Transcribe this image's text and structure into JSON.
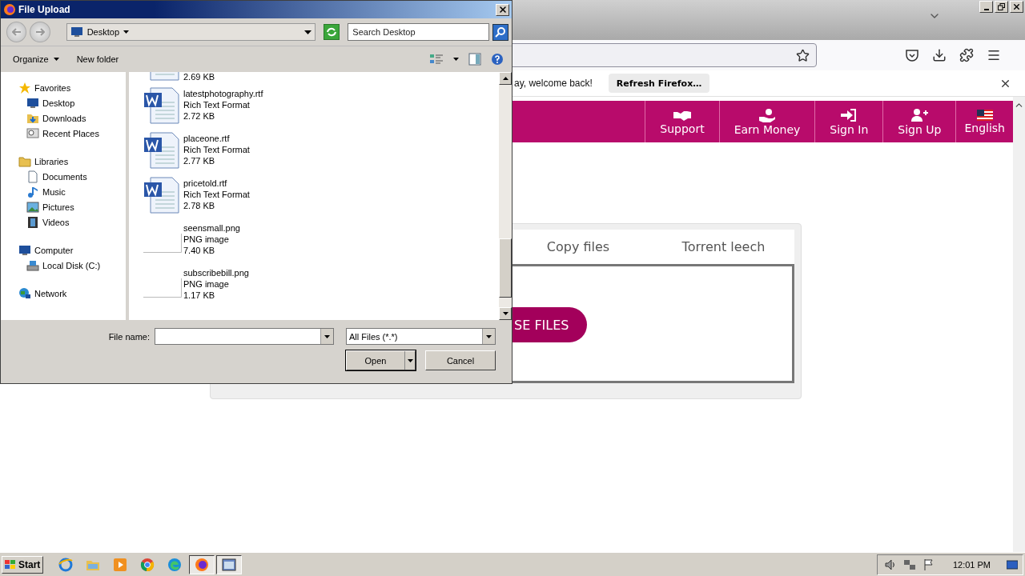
{
  "browser": {
    "notification": {
      "message": "ay, welcome back!",
      "button": "Refresh Firefox…"
    }
  },
  "site": {
    "nav": [
      {
        "label": "Support"
      },
      {
        "label": "Earn Money"
      },
      {
        "label": "Sign In"
      },
      {
        "label": "Sign Up"
      },
      {
        "label": "English"
      }
    ],
    "tabs": [
      {
        "label": "Copy files"
      },
      {
        "label": "Torrent leech"
      }
    ],
    "choose_button": "SE FILES"
  },
  "dialog": {
    "title": "File Upload",
    "location": "Desktop",
    "search": {
      "placeholder": "Search Desktop"
    },
    "commands": [
      {
        "label": "Organize",
        "kind": "menu"
      },
      {
        "label": "New folder",
        "kind": "plain"
      }
    ],
    "navigation": [
      {
        "label": "Favorites",
        "children": [
          {
            "label": "Desktop"
          },
          {
            "label": "Downloads"
          },
          {
            "label": "Recent Places"
          }
        ]
      },
      {
        "label": "Libraries",
        "children": [
          {
            "label": "Documents"
          },
          {
            "label": "Music"
          },
          {
            "label": "Pictures"
          },
          {
            "label": "Videos"
          }
        ]
      },
      {
        "label": "Computer",
        "children": [
          {
            "label": "Local Disk (C:)"
          }
        ]
      },
      {
        "label": "Network"
      }
    ],
    "files": [
      {
        "kind": "partial",
        "size": "2.69 KB"
      },
      {
        "kind": "document",
        "name": "latestphotography.rtf",
        "type": "Rich Text Format",
        "size": "2.72 KB"
      },
      {
        "kind": "document",
        "name": "placeone.rtf",
        "type": "Rich Text Format",
        "size": "2.77 KB"
      },
      {
        "kind": "document",
        "name": "pricetold.rtf",
        "type": "Rich Text Format",
        "size": "2.78 KB"
      },
      {
        "kind": "image",
        "name": "seensmall.png",
        "type": "PNG image",
        "size": "7.40 KB"
      },
      {
        "kind": "image",
        "name": "subscribebill.png",
        "type": "PNG image",
        "size": "1.17 KB"
      }
    ],
    "file_name_label": "File name:",
    "file_type": "All Files (*.*)",
    "buttons": [
      {
        "label": "Open",
        "kind": "split"
      },
      {
        "label": "Cancel",
        "kind": "plain"
      }
    ]
  },
  "taskbar": {
    "start": "Start",
    "apps": [
      {
        "active": false
      },
      {
        "active": false
      },
      {
        "active": false
      },
      {
        "active": false
      },
      {
        "active": false
      },
      {
        "active": true
      },
      {
        "active": true
      }
    ],
    "clock": "12:01 PM"
  }
}
